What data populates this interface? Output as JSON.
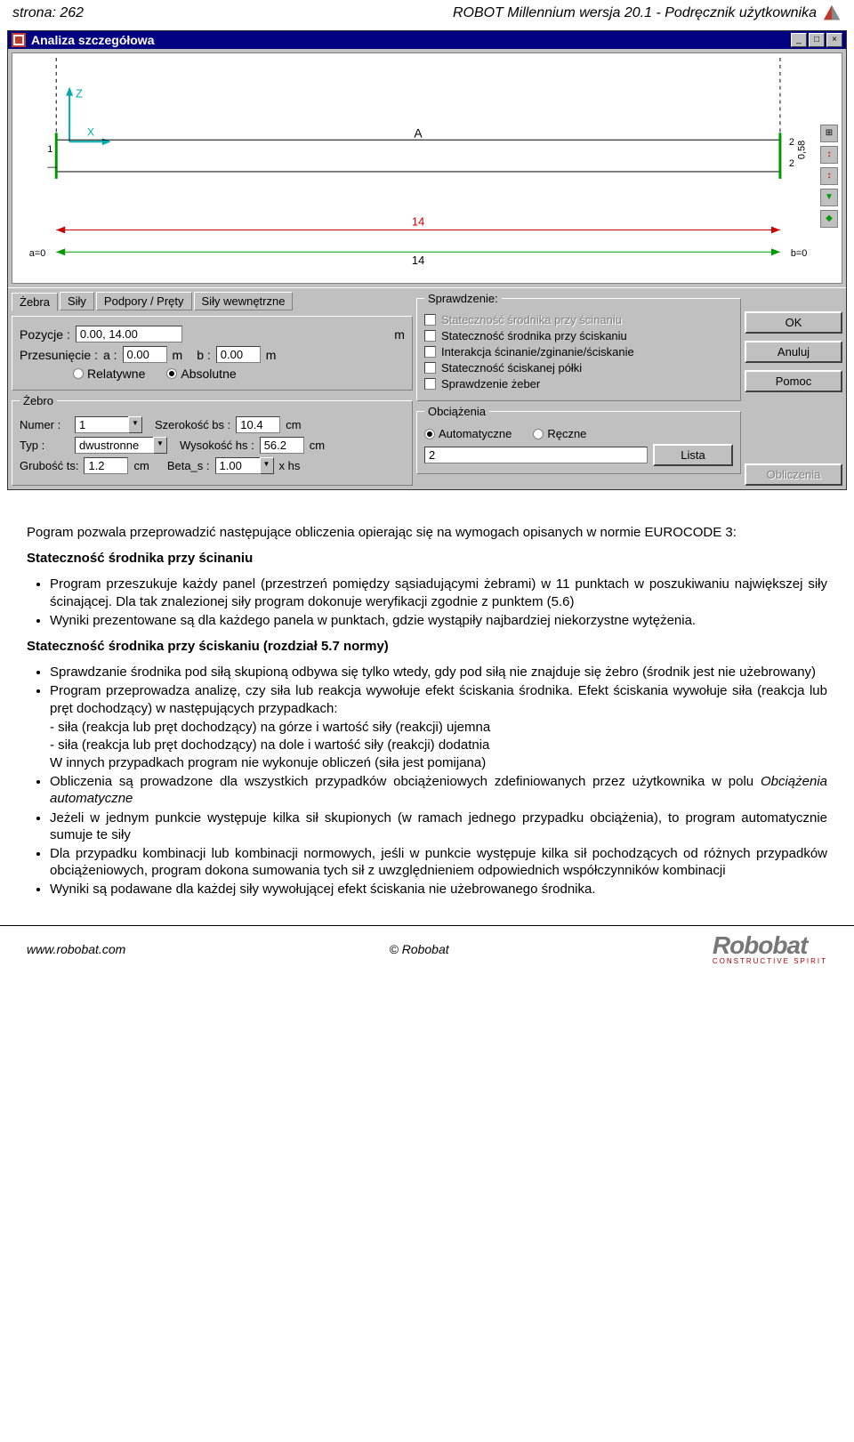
{
  "header": {
    "page_left": "strona: 262",
    "page_center": "ROBOT Millennium wersja 20.1 - Podręcznik użytkownika"
  },
  "window": {
    "title": "Analiza szczegółowa",
    "viewport": {
      "axis_z": "Z",
      "axis_x": "X",
      "member_label": "A",
      "dim_top": "14",
      "a_label": "a=0",
      "b_label": "b=0",
      "dim_bottom": "14",
      "left_num": "1",
      "right_num1": "2",
      "right_num2": "2",
      "right_h": "0,58"
    },
    "tabs": [
      "Żebra",
      "Siły",
      "Podpory / Pręty",
      "Siły wewnętrzne"
    ],
    "tab_panel": {
      "pozycje_label": "Pozycje :",
      "pozycje_value": "0.00, 14.00",
      "m1": "m",
      "przesuniecie_label": "Przesunięcie :",
      "a_label": "a :",
      "a_value": "0.00",
      "m2": "m",
      "b_label": "b :",
      "b_value": "0.00",
      "m3": "m",
      "radio_rel": "Relatywne",
      "radio_abs": "Absolutne"
    },
    "zebro": {
      "legend": "Żebro",
      "numer_label": "Numer :",
      "numer_value": "1",
      "szer_label": "Szerokość bs :",
      "szer_value": "10.4",
      "szer_unit": "cm",
      "typ_label": "Typ :",
      "typ_value": "dwustronne",
      "wys_label": "Wysokość hs :",
      "wys_value": "56.2",
      "wys_unit": "cm",
      "grub_label": "Grubość ts:",
      "grub_value": "1.2",
      "grub_unit": "cm",
      "beta_label": "Beta_s :",
      "beta_value": "1.00",
      "beta_suffix": "x  hs"
    },
    "sprawdzenie": {
      "legend": "Sprawdzenie:",
      "items": [
        {
          "label": "Stateczność środnika przy ścinaniu",
          "disabled": true
        },
        {
          "label": "Stateczność środnika przy ściskaniu",
          "disabled": false
        },
        {
          "label": "Interakcja ścinanie/zginanie/ściskanie",
          "disabled": false
        },
        {
          "label": "Stateczność ściskanej półki",
          "disabled": false
        },
        {
          "label": "Sprawdzenie żeber",
          "disabled": false
        }
      ]
    },
    "obciazenia": {
      "legend": "Obciążenia",
      "radio_auto": "Automatyczne",
      "radio_reczne": "Ręczne",
      "value": "2",
      "lista_btn": "Lista"
    },
    "buttons": {
      "ok": "OK",
      "anuluj": "Anuluj",
      "pomoc": "Pomoc",
      "obliczenia": "Obliczenia"
    }
  },
  "doc": {
    "intro": "Pogram pozwala przeprowadzić następujące obliczenia opierając się na wymogach opisanych w normie EUROCODE 3:",
    "sec1_title": "Stateczność środnika przy ścinaniu",
    "sec1_items": [
      "Program przeszukuje każdy panel (przestrzeń pomiędzy sąsiadującymi żebrami) w 11 punktach w poszukiwaniu największej siły ścinającej. Dla tak znalezionej siły program dokonuje weryfikacji zgodnie z punktem (5.6)",
      "Wyniki prezentowane są dla każdego panela w punktach, gdzie wystąpiły najbardziej niekorzystne wytężenia."
    ],
    "sec2_title": "Stateczność środnika przy ściskaniu (rozdział 5.7 normy)",
    "sec2_items": [
      "Sprawdzanie środnika pod siłą skupioną odbywa się tylko wtedy, gdy pod siłą nie znajduje się żebro (środnik jest nie użebrowany)",
      "Program przeprowadza analizę, czy siła lub reakcja wywołuje efekt ściskania środnika. Efekt ściskania wywołuje siła (reakcja lub pręt dochodzący) w następujących przypadkach:\n- siła (reakcja lub pręt dochodzący) na górze i wartość siły (reakcji) ujemna\n- siła (reakcja lub pręt dochodzący) na dole i wartość siły (reakcji) dodatnia\nW innych przypadkach program nie wykonuje obliczeń (siła jest pomijana)",
      "Obliczenia są prowadzone dla wszystkich przypadków obciążeniowych zdefiniowanych przez użytkownika w polu Obciążenia automatyczne",
      "Jeżeli w jednym punkcie występuje kilka sił skupionych (w ramach jednego przypadku obciążenia), to program automatycznie sumuje te siły",
      "Dla przypadku kombinacji lub kombinacji normowych, jeśli w punkcie występuje kilka sił pochodzących od różnych przypadków obciążeniowych, program dokona sumowania tych sił z uwzględnieniem odpowiednich współczynników kombinacji",
      "Wyniki są podawane dla każdej siły wywołującej efekt ściskania nie użebrowanego środnika."
    ]
  },
  "footer": {
    "url": "www.robobat.com",
    "copyright": "© Robobat",
    "brand": "Robobat",
    "tagline": "CONSTRUCTIVE SPIRIT"
  }
}
